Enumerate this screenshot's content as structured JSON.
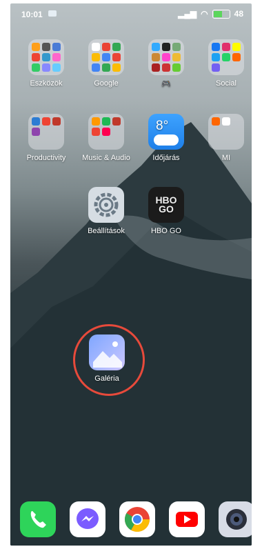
{
  "status_bar": {
    "time": "10:01",
    "battery": "48"
  },
  "apps": {
    "eszkozok": "Eszközök",
    "google": "Google",
    "games": "🎮",
    "social": "Social",
    "productivity": "Productivity",
    "music_audio": "Music & Audio",
    "idojaras": "Időjárás",
    "mi": "MI",
    "beallitasok": "Beállítások",
    "hbo_go": "HBO GO",
    "galeria": "Galéria"
  },
  "weather_temp": "8°",
  "hbo_logo": [
    "HBO",
    "GO"
  ],
  "highlight_color": "#e74a3b",
  "dock": [
    "phone-icon",
    "messenger-icon",
    "chrome-icon",
    "youtube-icon",
    "camera-icon"
  ]
}
